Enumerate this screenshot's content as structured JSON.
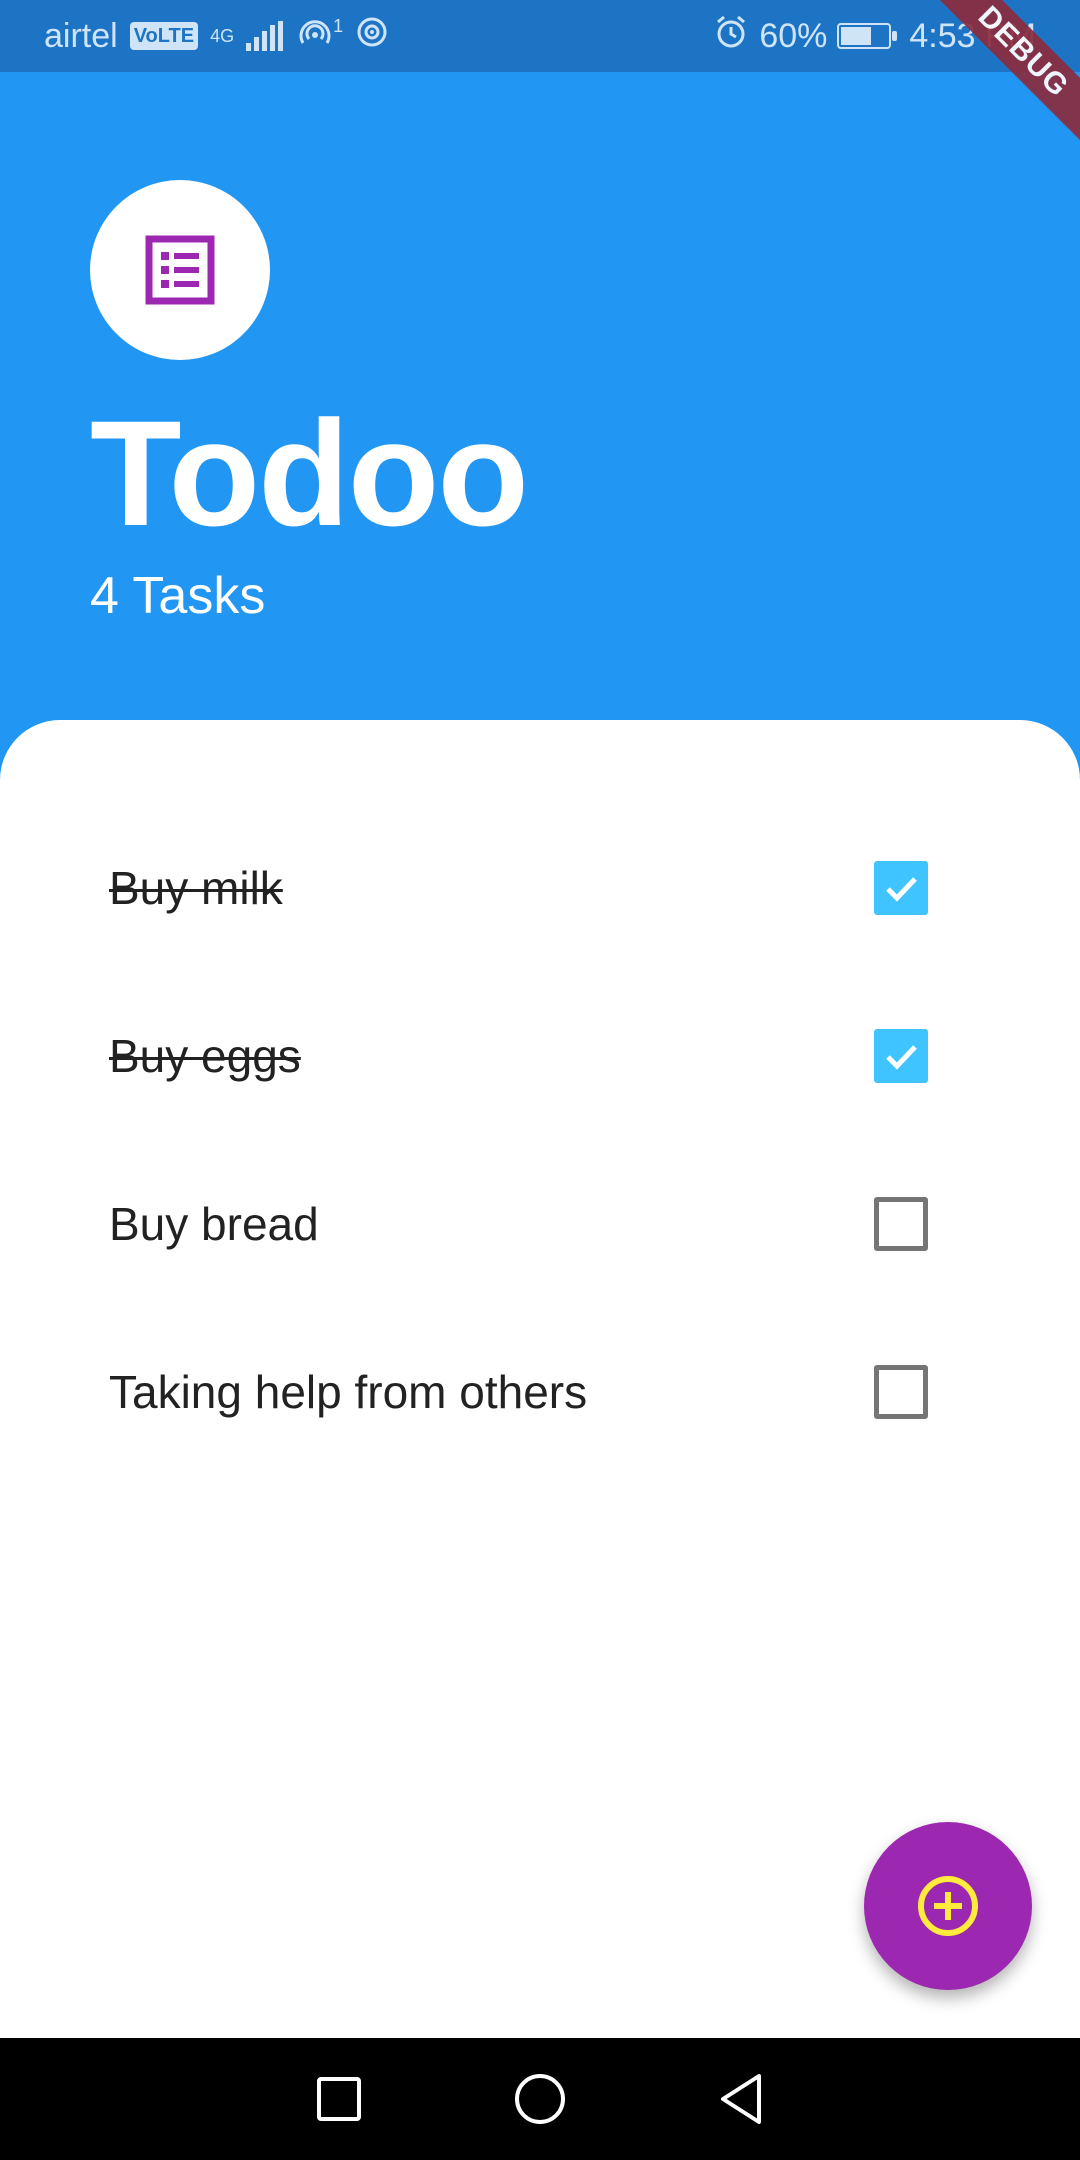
{
  "status_bar": {
    "carrier": "airtel",
    "volte": "VoLTE",
    "network": "4G",
    "hotspot_count": "1",
    "battery": "60%",
    "time": "4:53 PM"
  },
  "debug_banner": "DEBUG",
  "header": {
    "icon": "list-alt-icon",
    "title": "Todoo",
    "subtitle": "4 Tasks"
  },
  "tasks": [
    {
      "label": "Buy milk",
      "done": true
    },
    {
      "label": "Buy eggs",
      "done": true
    },
    {
      "label": "Buy bread",
      "done": false
    },
    {
      "label": "Taking help from others",
      "done": false
    }
  ],
  "fab": {
    "icon": "add-circle-icon"
  },
  "colors": {
    "header_bg": "#2196F3",
    "status_bar_bg": "#1E74C4",
    "accent_check": "#40C4FF",
    "fab_bg": "#9C27B0",
    "fab_icon": "#FFEB3B",
    "avatar_icon": "#9C27B0"
  },
  "nav": [
    "square-icon",
    "circle-icon",
    "back-triangle-icon"
  ]
}
